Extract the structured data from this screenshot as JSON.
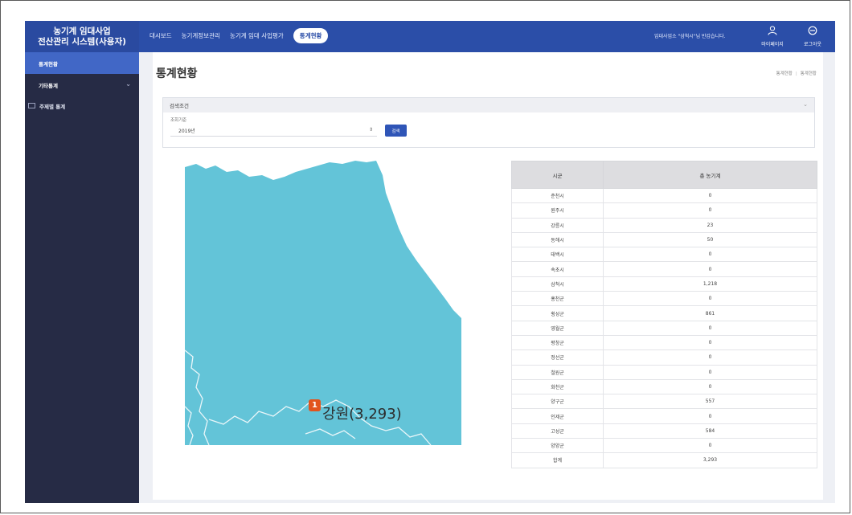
{
  "header": {
    "brand_line1": "농기계 임대사업",
    "brand_line2": "전산관리 시스템(사용자)",
    "nav": [
      {
        "label": "대시보드"
      },
      {
        "label": "농기계정보관리"
      },
      {
        "label": "농기계 임대 사업평가"
      },
      {
        "label": "통계현황"
      }
    ],
    "welcome": "임대사업소 \"삼척시\"님 반갑습니다.",
    "mypage_label": "마이페이지",
    "logout_label": "로그아웃"
  },
  "sidebar": {
    "items": [
      {
        "label": "통계현황"
      },
      {
        "label": "기타통계"
      },
      {
        "label": "주제별 통계"
      }
    ]
  },
  "page": {
    "title": "통계현황",
    "breadcrumb": [
      "통계현황",
      "통계현황"
    ]
  },
  "search": {
    "header": "검색조건",
    "field_label": "조회기준",
    "year_value": "2019년",
    "button": "검색"
  },
  "map": {
    "marker": "1",
    "region_label": "강원(3,293)",
    "fill_color": "#63c4d8"
  },
  "table": {
    "headers": [
      "시군",
      "총 농기계"
    ],
    "rows": [
      [
        "춘천시",
        "0"
      ],
      [
        "원주시",
        "0"
      ],
      [
        "강릉시",
        "23"
      ],
      [
        "동해시",
        "50"
      ],
      [
        "태백시",
        "0"
      ],
      [
        "속초시",
        "0"
      ],
      [
        "삼척시",
        "1,218"
      ],
      [
        "홍천군",
        "0"
      ],
      [
        "횡성군",
        "861"
      ],
      [
        "영월군",
        "0"
      ],
      [
        "평창군",
        "0"
      ],
      [
        "정선군",
        "0"
      ],
      [
        "철원군",
        "0"
      ],
      [
        "화천군",
        "0"
      ],
      [
        "양구군",
        "557"
      ],
      [
        "인제군",
        "0"
      ],
      [
        "고성군",
        "584"
      ],
      [
        "양양군",
        "0"
      ],
      [
        "합계",
        "3,293"
      ]
    ]
  }
}
